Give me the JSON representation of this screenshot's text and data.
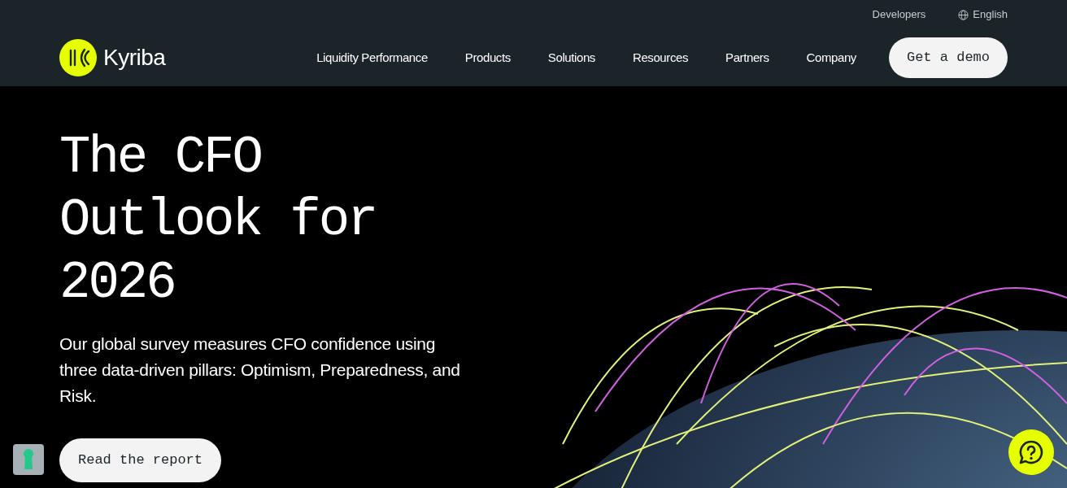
{
  "utility_links": [
    {
      "label": "Developers",
      "icon": false
    },
    {
      "label": "English",
      "icon": true
    }
  ],
  "logo": {
    "text": "Kyriba"
  },
  "nav": [
    {
      "label": "Liquidity Performance"
    },
    {
      "label": "Products"
    },
    {
      "label": "Solutions"
    },
    {
      "label": "Resources"
    },
    {
      "label": "Partners"
    },
    {
      "label": "Company"
    }
  ],
  "header_button": "Get a demo",
  "hero": {
    "title": "The CFO Outlook for 2026",
    "description": "Our global survey measures CFO confidence using three data-driven pillars: Optimism, Preparedness, and Risk.",
    "button": "Read the report"
  }
}
